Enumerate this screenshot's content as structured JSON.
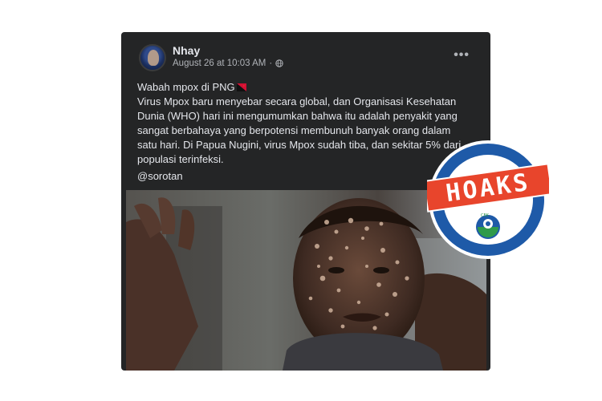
{
  "post": {
    "author": "Nhay",
    "timestamp": "August 26 at 10:03 AM",
    "separator": "·",
    "privacy_icon": "globe-icon",
    "more_icon": "more-options-icon",
    "more_label": "•••",
    "headline": "Wabah mpox di PNG",
    "headline_emoji": "flag-icon",
    "body": "Virus Mpox baru menyebar secara global, dan Organisasi Kesehatan Dunia (WHO) hari ini mengumumkan bahwa itu adalah penyakit yang sangat berbahaya yang berpotensi membunuh banyak orang dalam satu hari. Di Papua Nugini, virus Mpox sudah tiba, dan sekitar 5% dari populasi terinfeksi.",
    "handle": "@sorotan",
    "photo_icon": "photo-man-with-skin-lesions"
  },
  "stamp": {
    "label": "HOAKS",
    "colors": {
      "ring": "#1e5aa8",
      "banner": "#e8452c",
      "inner": "#ffffff"
    }
  },
  "colors": {
    "post_bg": "#242526",
    "text": "#e4e6eb",
    "muted": "#b0b3b8"
  }
}
